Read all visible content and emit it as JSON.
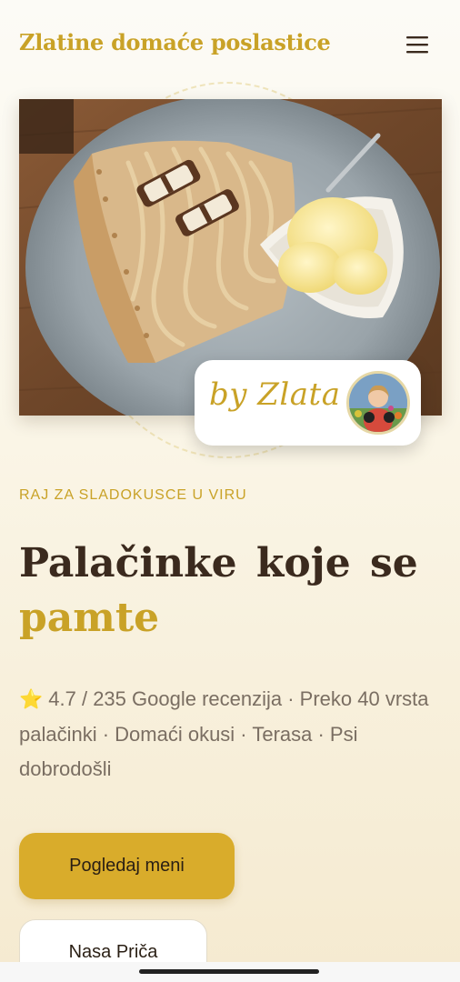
{
  "header": {
    "brand": "Zlatine domaće poslastice",
    "menu_icon": "hamburger-menu-icon"
  },
  "hero": {
    "badge_text": "by Zlata",
    "avatar_icon": "chef-portrait"
  },
  "content": {
    "kicker": "RAJ ZA SLADOKUSCE U VIRU",
    "title_line1": "Palačinke koje se",
    "title_line2": "pamte",
    "star": "⭐",
    "description": "4.7 / 235 Google recenzija · Preko 40 vrsta palačinki · Domaći okusi · Terasa · Psi dobrodošli"
  },
  "buttons": {
    "primary": "Pogledaj meni",
    "secondary": "Nasa Priča"
  },
  "colors": {
    "accent": "#c9a227",
    "button": "#d9ac2b",
    "title": "#3b2a1e",
    "text_muted": "#7a6e62"
  }
}
